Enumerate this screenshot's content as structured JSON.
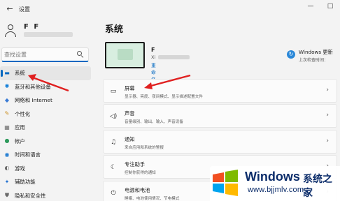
{
  "window": {
    "title": "设置",
    "back_glyph": "←",
    "minimize_glyph": "—",
    "maximize_glyph": "□"
  },
  "user": {
    "name": "F F"
  },
  "search": {
    "placeholder": "查找设置"
  },
  "sidebar": {
    "items": [
      {
        "label": "系统",
        "icon": "monitor-icon",
        "glyph": "▬",
        "color": "#0067c0",
        "selected": true
      },
      {
        "label": "蓝牙和其他设备",
        "icon": "bluetooth-icon",
        "glyph": "✱",
        "color": "#0a7ad8",
        "selected": false
      },
      {
        "label": "网络和 Internet",
        "icon": "wifi-icon",
        "glyph": "◆",
        "color": "#3a7bd5",
        "selected": false
      },
      {
        "label": "个性化",
        "icon": "brush-icon",
        "glyph": "✎",
        "color": "#c88a16",
        "selected": false
      },
      {
        "label": "应用",
        "icon": "apps-icon",
        "glyph": "▦",
        "color": "#6b6b6b",
        "selected": false
      },
      {
        "label": "帐户",
        "icon": "account-icon",
        "glyph": "●",
        "color": "#2e9a5c",
        "selected": false
      },
      {
        "label": "时间和语言",
        "icon": "globe-clock-icon",
        "glyph": "◉",
        "color": "#1f7bd1",
        "selected": false
      },
      {
        "label": "游戏",
        "icon": "gamepad-icon",
        "glyph": "◐",
        "color": "#6b6b6b",
        "selected": false
      },
      {
        "label": "辅助功能",
        "icon": "accessibility-icon",
        "glyph": "✦",
        "color": "#1f6fd0",
        "selected": false
      },
      {
        "label": "隐私和安全性",
        "icon": "shield-icon",
        "glyph": "⛊",
        "color": "#6b6b6b",
        "selected": false
      }
    ]
  },
  "page": {
    "title": "系统"
  },
  "device": {
    "name": "F",
    "model_prefix": "Xi",
    "rename_label": "重命名"
  },
  "windows_update": {
    "title": "Windows 更新",
    "status": "上次检查时间：",
    "glyph": "↻"
  },
  "cards": [
    {
      "title": "屏幕",
      "desc": "显示器、亮度、夜间模式、显示描述配置文件",
      "icon": "display-icon",
      "glyph": "▭"
    },
    {
      "title": "声音",
      "desc": "音量级别、输出、输入、声音设备",
      "icon": "speaker-icon",
      "glyph": "◁)"
    },
    {
      "title": "通知",
      "desc": "来自应用和系统的警报",
      "icon": "bell-icon",
      "glyph": "♫"
    },
    {
      "title": "专注助手",
      "desc": "控制你获得的通知",
      "icon": "moon-icon",
      "glyph": "☾"
    },
    {
      "title": "电源和电池",
      "desc": "睡眠、电池使用情况、节电模式",
      "icon": "power-icon",
      "glyph": "⏻"
    }
  ],
  "chevron_glyph": "›",
  "watermark": {
    "brand": "Windows",
    "tagline": "系统之家",
    "url": "www.bjjmlv.com"
  },
  "colors": {
    "accent": "#0067c0",
    "annotation_arrow": "#e02020",
    "watermark_text": "#0b2c6a"
  }
}
